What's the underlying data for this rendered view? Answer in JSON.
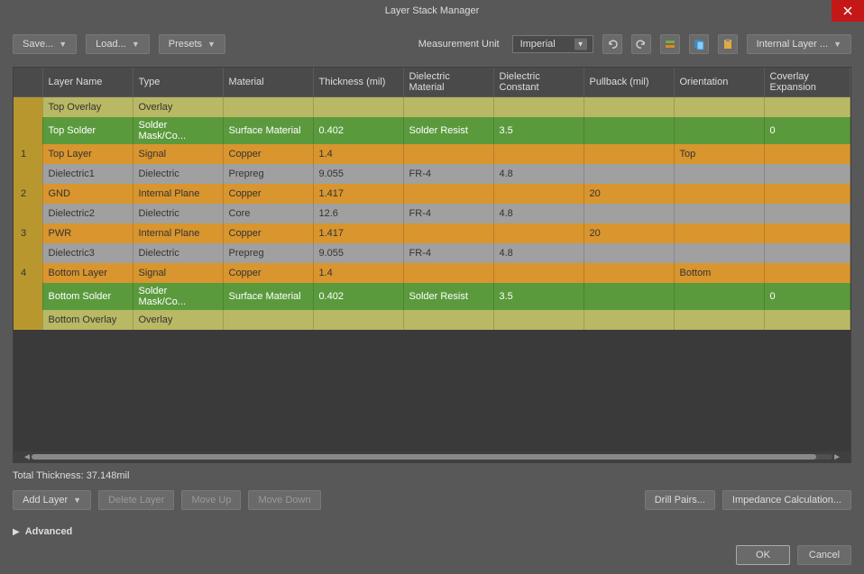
{
  "title": "Layer Stack Manager",
  "toolbar": {
    "save": "Save...",
    "load": "Load...",
    "presets": "Presets",
    "measurement_label": "Measurement Unit",
    "measurement_value": "Imperial",
    "internal_layer": "Internal Layer ..."
  },
  "columns": {
    "num": "",
    "name": "Layer Name",
    "type": "Type",
    "material": "Material",
    "thickness": "Thickness (mil)",
    "dmaterial": "Dielectric Material",
    "dconstant": "Dielectric Constant",
    "pullback": "Pullback (mil)",
    "orientation": "Orientation",
    "coverlay": "Coverlay Expansion"
  },
  "rows": [
    {
      "cls": "olive",
      "num": "",
      "name": "Top Overlay",
      "type": "Overlay",
      "material": "",
      "thickness": "",
      "dmaterial": "",
      "dconstant": "",
      "pullback": "",
      "orientation": "",
      "coverlay": ""
    },
    {
      "cls": "green",
      "num": "",
      "name": "Top Solder",
      "type": "Solder Mask/Co...",
      "material": "Surface Material",
      "thickness": "0.402",
      "dmaterial": "Solder Resist",
      "dconstant": "3.5",
      "pullback": "",
      "orientation": "",
      "coverlay": "0"
    },
    {
      "cls": "orange",
      "num": "1",
      "name": "Top Layer",
      "type": "Signal",
      "material": "Copper",
      "thickness": "1.4",
      "dmaterial": "",
      "dconstant": "",
      "pullback": "",
      "orientation": "Top",
      "coverlay": ""
    },
    {
      "cls": "gray",
      "num": "",
      "name": "Dielectric1",
      "type": "Dielectric",
      "material": "Prepreg",
      "thickness": "9.055",
      "dmaterial": "FR-4",
      "dconstant": "4.8",
      "pullback": "",
      "orientation": "",
      "coverlay": ""
    },
    {
      "cls": "orange",
      "num": "2",
      "name": "GND",
      "type": "Internal Plane",
      "material": "Copper",
      "thickness": "1.417",
      "dmaterial": "",
      "dconstant": "",
      "pullback": "20",
      "orientation": "",
      "coverlay": ""
    },
    {
      "cls": "gray",
      "num": "",
      "name": "Dielectric2",
      "type": "Dielectric",
      "material": "Core",
      "thickness": "12.6",
      "dmaterial": "FR-4",
      "dconstant": "4.8",
      "pullback": "",
      "orientation": "",
      "coverlay": ""
    },
    {
      "cls": "orange",
      "num": "3",
      "name": "PWR",
      "type": "Internal Plane",
      "material": "Copper",
      "thickness": "1.417",
      "dmaterial": "",
      "dconstant": "",
      "pullback": "20",
      "orientation": "",
      "coverlay": ""
    },
    {
      "cls": "gray",
      "num": "",
      "name": "Dielectric3",
      "type": "Dielectric",
      "material": "Prepreg",
      "thickness": "9.055",
      "dmaterial": "FR-4",
      "dconstant": "4.8",
      "pullback": "",
      "orientation": "",
      "coverlay": ""
    },
    {
      "cls": "orange",
      "num": "4",
      "name": "Bottom Layer",
      "type": "Signal",
      "material": "Copper",
      "thickness": "1.4",
      "dmaterial": "",
      "dconstant": "",
      "pullback": "",
      "orientation": "Bottom",
      "coverlay": ""
    },
    {
      "cls": "green",
      "num": "",
      "name": "Bottom Solder",
      "type": "Solder Mask/Co...",
      "material": "Surface Material",
      "thickness": "0.402",
      "dmaterial": "Solder Resist",
      "dconstant": "3.5",
      "pullback": "",
      "orientation": "",
      "coverlay": "0"
    },
    {
      "cls": "olive",
      "num": "",
      "name": "Bottom Overlay",
      "type": "Overlay",
      "material": "",
      "thickness": "",
      "dmaterial": "",
      "dconstant": "",
      "pullback": "",
      "orientation": "",
      "coverlay": ""
    }
  ],
  "status": "Total Thickness: 37.148mil",
  "bottombar": {
    "add": "Add Layer",
    "delete": "Delete Layer",
    "up": "Move Up",
    "down": "Move Down",
    "drill": "Drill Pairs...",
    "impedance": "Impedance Calculation..."
  },
  "advanced": "Advanced",
  "footer": {
    "ok": "OK",
    "cancel": "Cancel"
  }
}
